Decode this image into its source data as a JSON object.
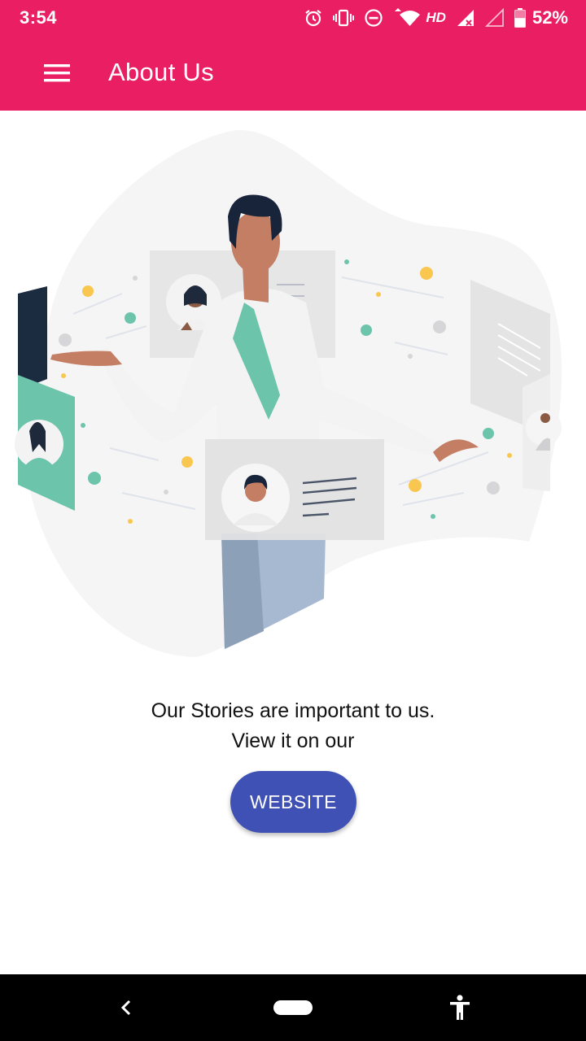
{
  "status_bar": {
    "time": "3:54",
    "network_label": "HD",
    "battery_percent": "52%",
    "icons": [
      "alarm-icon",
      "vibrate-icon",
      "do-not-disturb-icon",
      "wifi-icon",
      "signal-icon",
      "signal-empty-icon",
      "battery-icon"
    ]
  },
  "toolbar": {
    "title": "About Us",
    "menu_icon": "hamburger-menu-icon",
    "background_color": "#e91e63"
  },
  "content": {
    "message_line1": "Our Stories are important to us.",
    "message_line2": "View it on our",
    "button_label": "WEBSITE",
    "button_color": "#3f51b5"
  },
  "nav_bar": {
    "icons": [
      "back-icon",
      "home-pill-icon",
      "accessibility-icon"
    ]
  }
}
